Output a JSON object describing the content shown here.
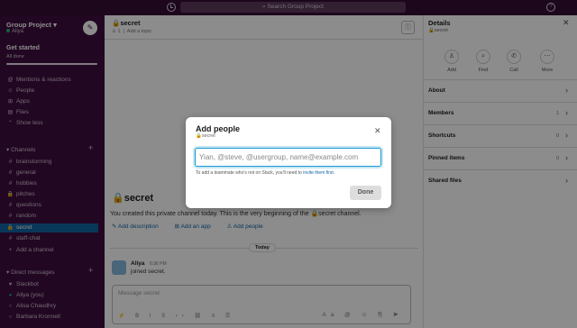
{
  "topbar": {
    "search_placeholder": "Search Group Project"
  },
  "sidebar": {
    "workspace": "Group Project",
    "user": "Aliya",
    "get_started": "Get started",
    "progress_status": "All done",
    "progress_fraction": 1.0,
    "nav": [
      {
        "label": "Mentions & reactions",
        "icon": "at-icon"
      },
      {
        "label": "People",
        "icon": "people-icon"
      },
      {
        "label": "Apps",
        "icon": "apps-icon"
      },
      {
        "label": "Files",
        "icon": "files-icon"
      },
      {
        "label": "Show less",
        "icon": "chevron-up-icon"
      }
    ],
    "channels_header": "Channels",
    "channels": [
      {
        "label": "brainstorming",
        "prefix": "#"
      },
      {
        "label": "general",
        "prefix": "#"
      },
      {
        "label": "hobbies",
        "prefix": "#"
      },
      {
        "label": "pitches",
        "prefix": "🔒"
      },
      {
        "label": "questions",
        "prefix": "#"
      },
      {
        "label": "random",
        "prefix": "#"
      },
      {
        "label": "secret",
        "prefix": "🔒"
      },
      {
        "label": "staff-chat",
        "prefix": "#"
      }
    ],
    "add_channel": "Add a channel",
    "dm_header": "Direct messages",
    "dms": [
      {
        "label": "Slackbot"
      },
      {
        "label": "Aliya  (you)"
      },
      {
        "label": "Alisa Chaudhry"
      },
      {
        "label": "Barbara Kronnell"
      }
    ]
  },
  "channel": {
    "title": "🔒secret",
    "members": "1",
    "add_topic": "Add a topic",
    "intro_title": "🔒secret",
    "intro_text": "You created this private channel today. This is the very beginning of the 🔒secret channel.",
    "actions": [
      "Add description",
      "Add an app",
      "Add people"
    ],
    "today": "Today",
    "message": {
      "author": "Aliya",
      "time": "6:36 PM",
      "text": "joined secret."
    },
    "composer_placeholder": "Message secret"
  },
  "details": {
    "title": "Details",
    "subtitle": "🔒secret",
    "actions": [
      {
        "label": "Add",
        "icon": "add-person-icon"
      },
      {
        "label": "Find",
        "icon": "find-icon"
      },
      {
        "label": "Call",
        "icon": "phone-icon"
      },
      {
        "label": "More",
        "icon": "more-icon"
      }
    ],
    "rows": [
      {
        "label": "About",
        "count": ""
      },
      {
        "label": "Members",
        "count": "1"
      },
      {
        "label": "Shortcuts",
        "count": "0"
      },
      {
        "label": "Pinned items",
        "count": "0"
      },
      {
        "label": "Shared files",
        "count": ""
      }
    ]
  },
  "modal": {
    "title": "Add people",
    "subtitle": "🔒secret",
    "input_placeholder": "Yian, @steve, @usergroup, name@example.com",
    "hint_prefix": "To add a teammate who's not on Slack, you'll need to",
    "hint_link": "invite them first.",
    "done_label": "Done"
  },
  "colors": {
    "sidebar": "#3f0e40",
    "topbar": "#350d36",
    "selected": "#1164a3",
    "link": "#1264a3"
  }
}
